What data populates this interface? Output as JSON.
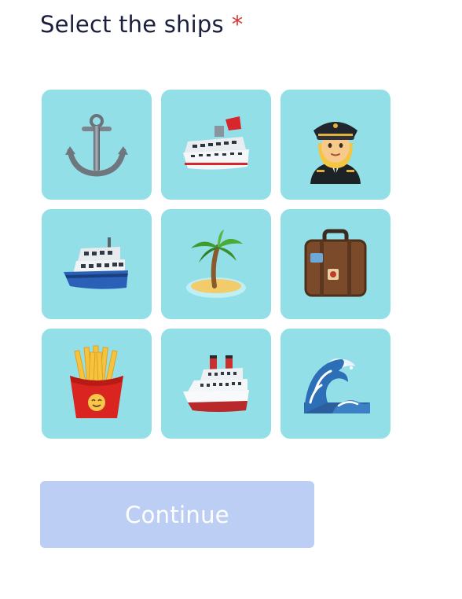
{
  "form": {
    "title": "Select the ships",
    "required_marker": "*",
    "tile_color": "#92dfe8"
  },
  "tiles": [
    {
      "icon": "anchor-icon"
    },
    {
      "icon": "cruise-ship-icon"
    },
    {
      "icon": "pilot-icon"
    },
    {
      "icon": "ferry-icon"
    },
    {
      "icon": "desert-island-icon"
    },
    {
      "icon": "suitcase-icon"
    },
    {
      "icon": "french-fries-icon"
    },
    {
      "icon": "ocean-liner-icon"
    },
    {
      "icon": "water-wave-icon"
    }
  ],
  "continue_button": {
    "label": "Continue",
    "color": "#bccef3",
    "state": "disabled"
  }
}
